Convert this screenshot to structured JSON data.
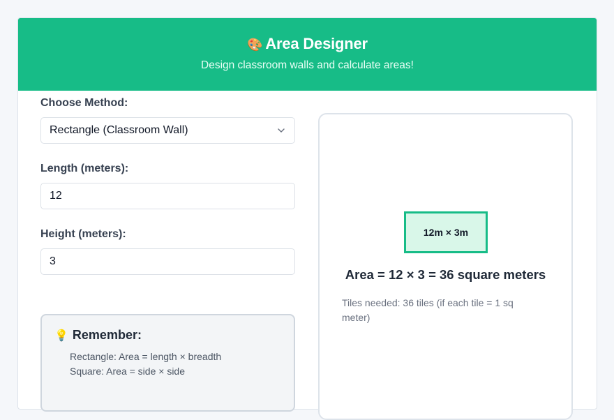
{
  "header": {
    "icon": "palette-icon",
    "emoji": "🎨",
    "title": "Area Designer",
    "subtitle": "Design classroom walls and calculate areas!"
  },
  "form": {
    "method_label": "Choose Method:",
    "method_value": "Rectangle (Classroom Wall)",
    "length_label": "Length (meters):",
    "length_value": "12",
    "height_label": "Height (meters):",
    "height_value": "3"
  },
  "tip": {
    "icon": "lightbulb-icon",
    "emoji": "💡",
    "title": "Remember:",
    "lines": [
      "Rectangle: Area = length × breadth",
      "Square: Area = side × side"
    ]
  },
  "preview": {
    "shape_label": "12m × 3m",
    "area_text": "Area = 12 × 3 = 36 square meters",
    "tiles_text": "Tiles needed: 36 tiles (if each tile = 1 sq meter)"
  },
  "colors": {
    "accent": "#17bc87",
    "shape_fill": "#d9f7e9"
  }
}
